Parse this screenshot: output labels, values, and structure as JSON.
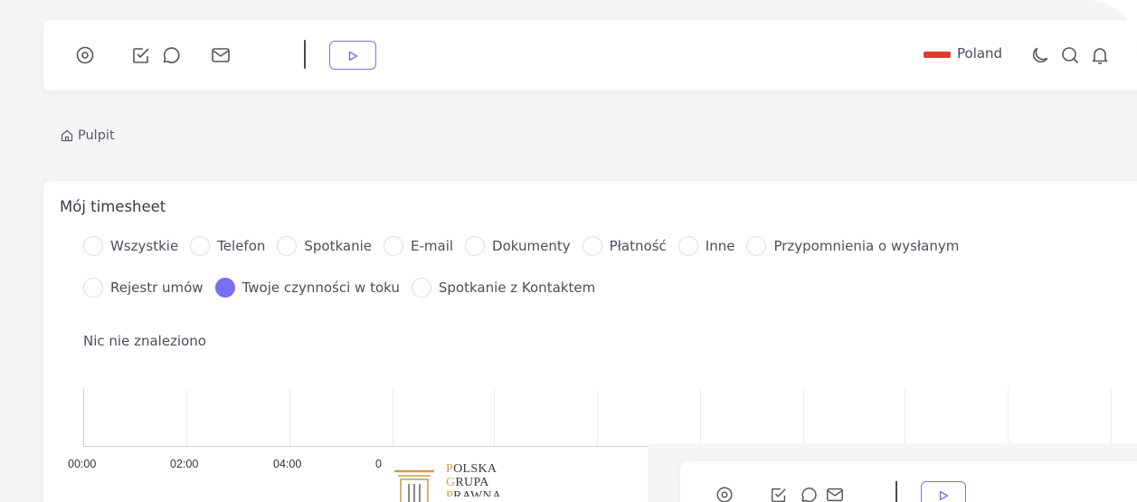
{
  "topbar": {
    "icons": [
      "target-icon",
      "checkbox-icon",
      "chat-icon",
      "mail-icon"
    ],
    "play_icon": "play-icon",
    "country": "Poland",
    "flag_color": "#e23b2e",
    "right_icons": [
      "moon-icon",
      "search-icon",
      "bell-icon"
    ]
  },
  "breadcrumb": {
    "icon": "home-icon",
    "label": "Pulpit"
  },
  "timesheet": {
    "title": "Mój timesheet",
    "filters_row1": [
      {
        "label": "Wszystkie",
        "selected": false
      },
      {
        "label": "Telefon",
        "selected": false
      },
      {
        "label": "Spotkanie",
        "selected": false
      },
      {
        "label": "E-mail",
        "selected": false
      },
      {
        "label": "Dokumenty",
        "selected": false
      },
      {
        "label": "Płatność",
        "selected": false
      },
      {
        "label": "Inne",
        "selected": false
      },
      {
        "label": "Przypomnienia o wysłanym",
        "selected": false
      }
    ],
    "filters_row2": [
      {
        "label": "Rejestr umów",
        "selected": false
      },
      {
        "label": "Twoje czynności w toku",
        "selected": true
      },
      {
        "label": "Spotkanie z Kontaktem",
        "selected": false
      }
    ],
    "empty_message": "Nic nie znaleziono",
    "timeline_labels": [
      "00:00",
      "02:00",
      "04:00",
      "0"
    ]
  },
  "logo": {
    "line1_cap": "P",
    "line1_rest": "OLSKA",
    "line2_cap": "G",
    "line2_rest": "RUPA",
    "line3_cap": "P",
    "line3_rest": "RAWNA"
  },
  "colors": {
    "accent": "#7a6ff0",
    "background": "#f5f5f7",
    "logo_gold": "#c9a24a"
  }
}
